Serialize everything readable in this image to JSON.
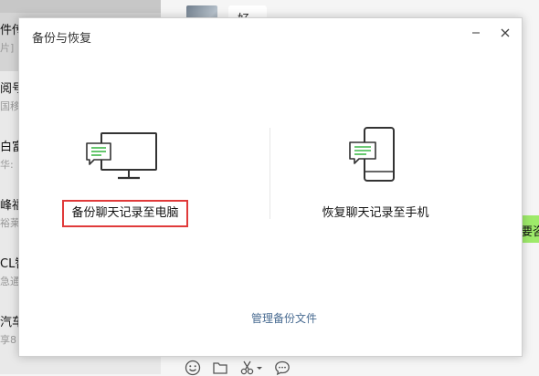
{
  "colors": {
    "accent_green": "#9eea6a",
    "highlight_red": "#e03a3a",
    "link_blue": "#4a6c92"
  },
  "background": {
    "chat_list": [
      {
        "name": "件传",
        "preview": "片]"
      },
      {
        "name": "阅号",
        "preview": "国移"
      },
      {
        "name": "白富",
        "preview": "华:"
      },
      {
        "name": "峰福",
        "preview": "裕莱"
      },
      {
        "name": "CL智",
        "preview": "急通"
      },
      {
        "name": "汽车",
        "preview": "享8"
      }
    ],
    "message_bubble_text": "好",
    "green_bubble_text": "要咨",
    "toolbar_icons": [
      "emoji-icon",
      "folder-icon",
      "scissors-icon",
      "chat-bubble-icon"
    ]
  },
  "dialog": {
    "title": "备份与恢复",
    "minimize_symbol": "−",
    "close_symbol": "×",
    "backup_label": "备份聊天记录至电脑",
    "restore_label": "恢复聊天记录至手机",
    "manage_label": "管理备份文件",
    "backup_icon": "computer-chat-icon",
    "restore_icon": "phone-chat-icon"
  }
}
